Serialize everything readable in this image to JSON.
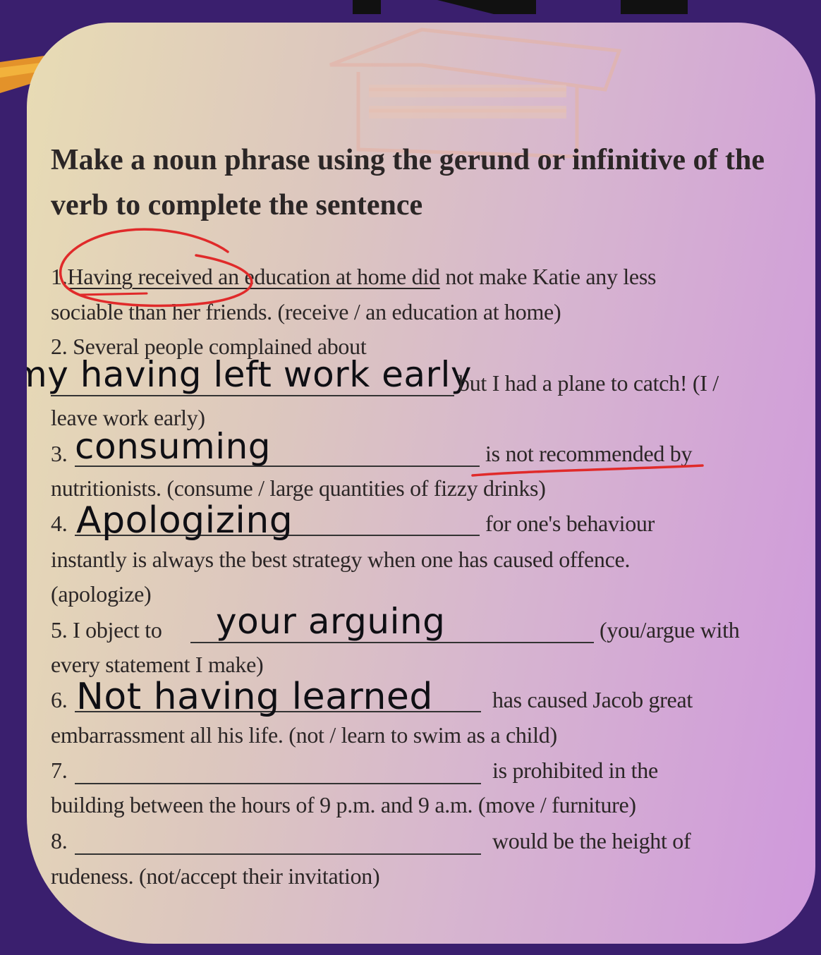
{
  "title": "Make a noun phrase using the gerund or infinitive of the verb to complete the sentence",
  "items": {
    "q1": {
      "number": "1.",
      "answer": "Having received an education at home did",
      "rest": " not make Katie any less",
      "line2": "sociable than her friends. (receive / an education at home)"
    },
    "q2": {
      "line1": "2. Several people complained about",
      "handwritten": "my having left work early",
      "rest": "but I had a plane to catch! (I /",
      "line3": "leave work early)"
    },
    "q3": {
      "number": "3.",
      "handwritten": "consuming",
      "rest_underlined": "is not recommended",
      "rest_tail": " by",
      "line2": "nutritionists. (consume / large quantities of fizzy drinks)"
    },
    "q4": {
      "number": "4.",
      "handwritten": "Apologizing",
      "rest": "for one's behaviour",
      "line2": "instantly is always the best strategy when one has caused offence.",
      "line3": "(apologize)"
    },
    "q5": {
      "prefix": "5. I object to",
      "handwritten": "your arguing",
      "rest": "(you/argue with",
      "line2": "every statement I make)"
    },
    "q6": {
      "number": "6.",
      "handwritten": "Not having learned",
      "rest": "has caused Jacob great",
      "line2": "embarrassment all his life. (not / learn to swim as a child)"
    },
    "q7": {
      "number": "7.",
      "rest": "is prohibited in the",
      "line2": "building between the hours of 9 p.m. and 9 a.m. (move / furniture)"
    },
    "q8": {
      "number": "8.",
      "rest": "would be the height of",
      "line2": "rudeness. (not/accept their invitation)"
    }
  },
  "colors": {
    "background": "#3a1f6e",
    "annotation_red": "#e02a2a",
    "text": "#2b2626"
  }
}
